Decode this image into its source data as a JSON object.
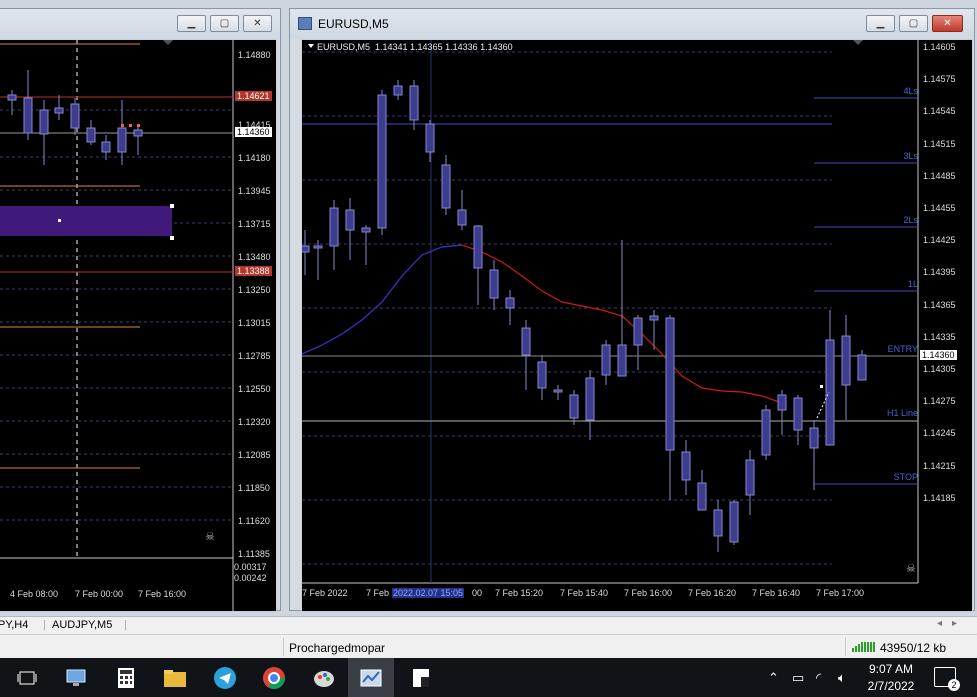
{
  "left_window": {
    "price_axis": [
      "1.14880",
      "1.14415",
      "1.14180",
      "1.13945",
      "1.13715",
      "1.13480",
      "1.13250",
      "1.13015",
      "1.12785",
      "1.12550",
      "1.12320",
      "1.12085",
      "1.11850",
      "1.11620",
      "1.11385"
    ],
    "price_tags": [
      {
        "label": "1.14621",
        "color": "#b3352b"
      },
      {
        "label": "1.14360",
        "color": "#ffffff"
      },
      {
        "label": "1.13388",
        "color": "#b3352b"
      }
    ],
    "indicator_axis": [
      "0.00317",
      "0.00242"
    ],
    "time_axis": [
      "4 Feb 08:00",
      "7 Feb 00:00",
      "7 Feb 16:00"
    ],
    "zone_color": "#3f1a7a"
  },
  "right_window": {
    "title": "EURUSD,M5",
    "ohlc_header": "EURUSD,M5  1.14341 1.14365 1.14336 1.14360",
    "price_axis": [
      "1.14605",
      "1.14575",
      "1.14545",
      "1.14515",
      "1.14485",
      "1.14455",
      "1.14425",
      "1.14395",
      "1.14365",
      "1.14335",
      "1.14305",
      "1.14275",
      "1.14245",
      "1.14215",
      "1.14185"
    ],
    "current_price_tag": "1.14360",
    "levels": [
      {
        "label": "4Ls",
        "color": "#4a62d0"
      },
      {
        "label": "3Ls",
        "color": "#4a62d0"
      },
      {
        "label": "2Ls",
        "color": "#4a62d0"
      },
      {
        "label": "1L",
        "color": "#4a62d0"
      },
      {
        "label": "ENTRY",
        "color": "#4a62d0"
      },
      {
        "label": "H1 Line",
        "color": "#4a62d0"
      },
      {
        "label": "STOP",
        "color": "#4a62d0"
      }
    ],
    "time_axis": [
      "7 Feb 2022",
      "7 Feb",
      "2022.02.07 15:05",
      "00",
      "7 Feb 15:20",
      "7 Feb 15:40",
      "7 Feb 16:00",
      "7 Feb 16:20",
      "7 Feb 16:40",
      "7 Feb 17:00"
    ],
    "candle_color": "#3d3d8f",
    "ma_blue": "#2233cc",
    "ma_red": "#cc1a1a"
  },
  "tabs": [
    "PY,H4",
    "AUDJPY,M5"
  ],
  "status": {
    "profile": "Prochargedmopar",
    "connection": "43950/12 kb"
  },
  "taskbar": {
    "time": "9:07 AM",
    "date": "2/7/2022",
    "notifications": "2"
  }
}
